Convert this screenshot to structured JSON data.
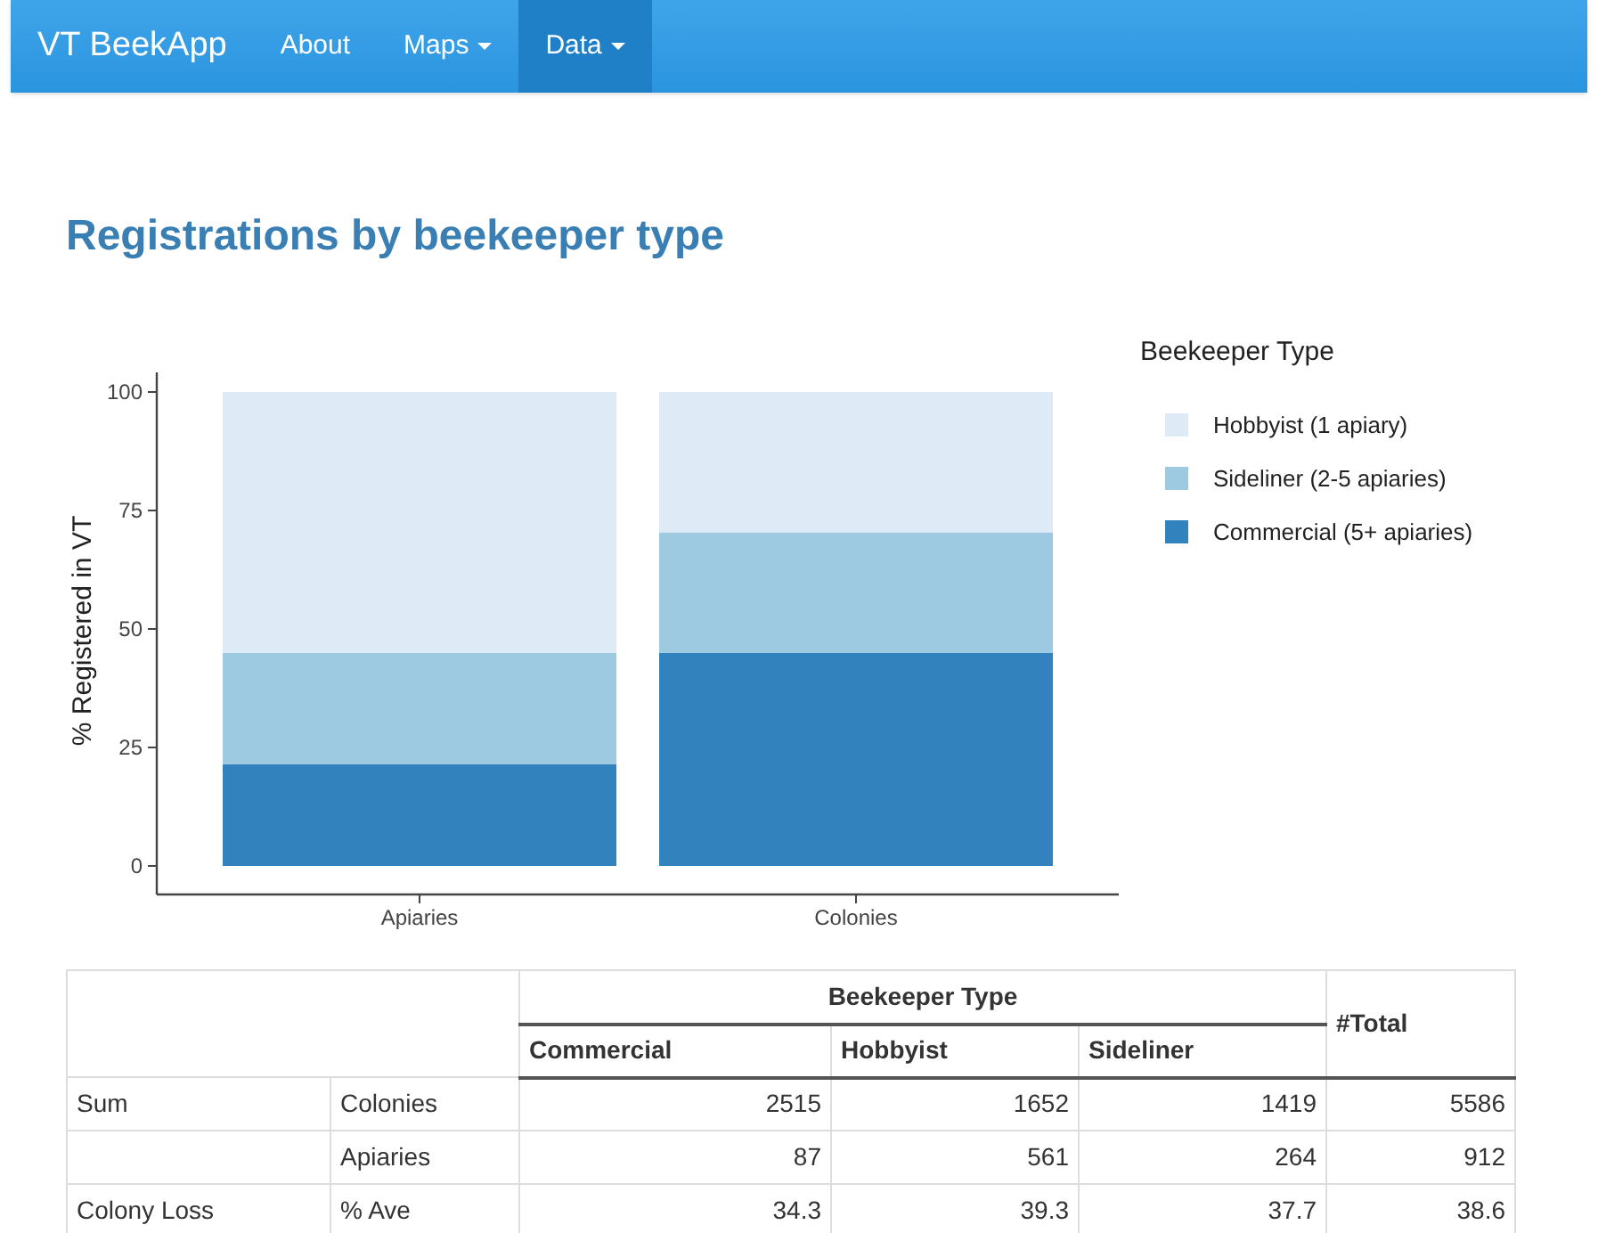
{
  "navbar": {
    "brand": "VT BeekApp",
    "items": [
      {
        "label": "About",
        "dropdown": false,
        "selected": false
      },
      {
        "label": "Maps",
        "dropdown": true,
        "selected": false
      },
      {
        "label": "Data",
        "dropdown": true,
        "selected": true
      }
    ]
  },
  "title": "Registrations by beekeeper type",
  "chart": {
    "chart_data": {
      "type": "bar",
      "stacked": true,
      "ylabel": "% Registered in VT",
      "categories": [
        "Apiaries",
        "Colonies"
      ],
      "ylim": [
        0,
        100
      ],
      "yticks": [
        0,
        25,
        50,
        75,
        100
      ],
      "legend": {
        "title": "Beekeeper Type"
      },
      "series": [
        {
          "name": "Commercial (5+ apiaries)",
          "color": "#3182bd",
          "values": [
            21.5,
            45
          ]
        },
        {
          "name": "Sideliner (2-5 apiaries)",
          "color": "#9ecae1",
          "values": [
            23.5,
            25.4
          ]
        },
        {
          "name": "Hobbyist (1 apiary)",
          "color": "#deebf7",
          "values": [
            55,
            29.6
          ]
        }
      ]
    }
  },
  "table": {
    "group_header": "Beekeeper Type",
    "columns": [
      "Commercial",
      "Hobbyist",
      "Sideliner"
    ],
    "total_header": "#Total",
    "rows": [
      {
        "group": "Sum",
        "measure": "Colonies",
        "values": [
          "2515",
          "1652",
          "1419"
        ],
        "total": "5586"
      },
      {
        "measure": "Apiaries",
        "values": [
          "87",
          "561",
          "264"
        ],
        "total": "912"
      },
      {
        "group": "Colony Loss",
        "measure": "% Ave",
        "values": [
          "34.3",
          "39.3",
          "37.7"
        ],
        "total": "38.6"
      }
    ]
  }
}
